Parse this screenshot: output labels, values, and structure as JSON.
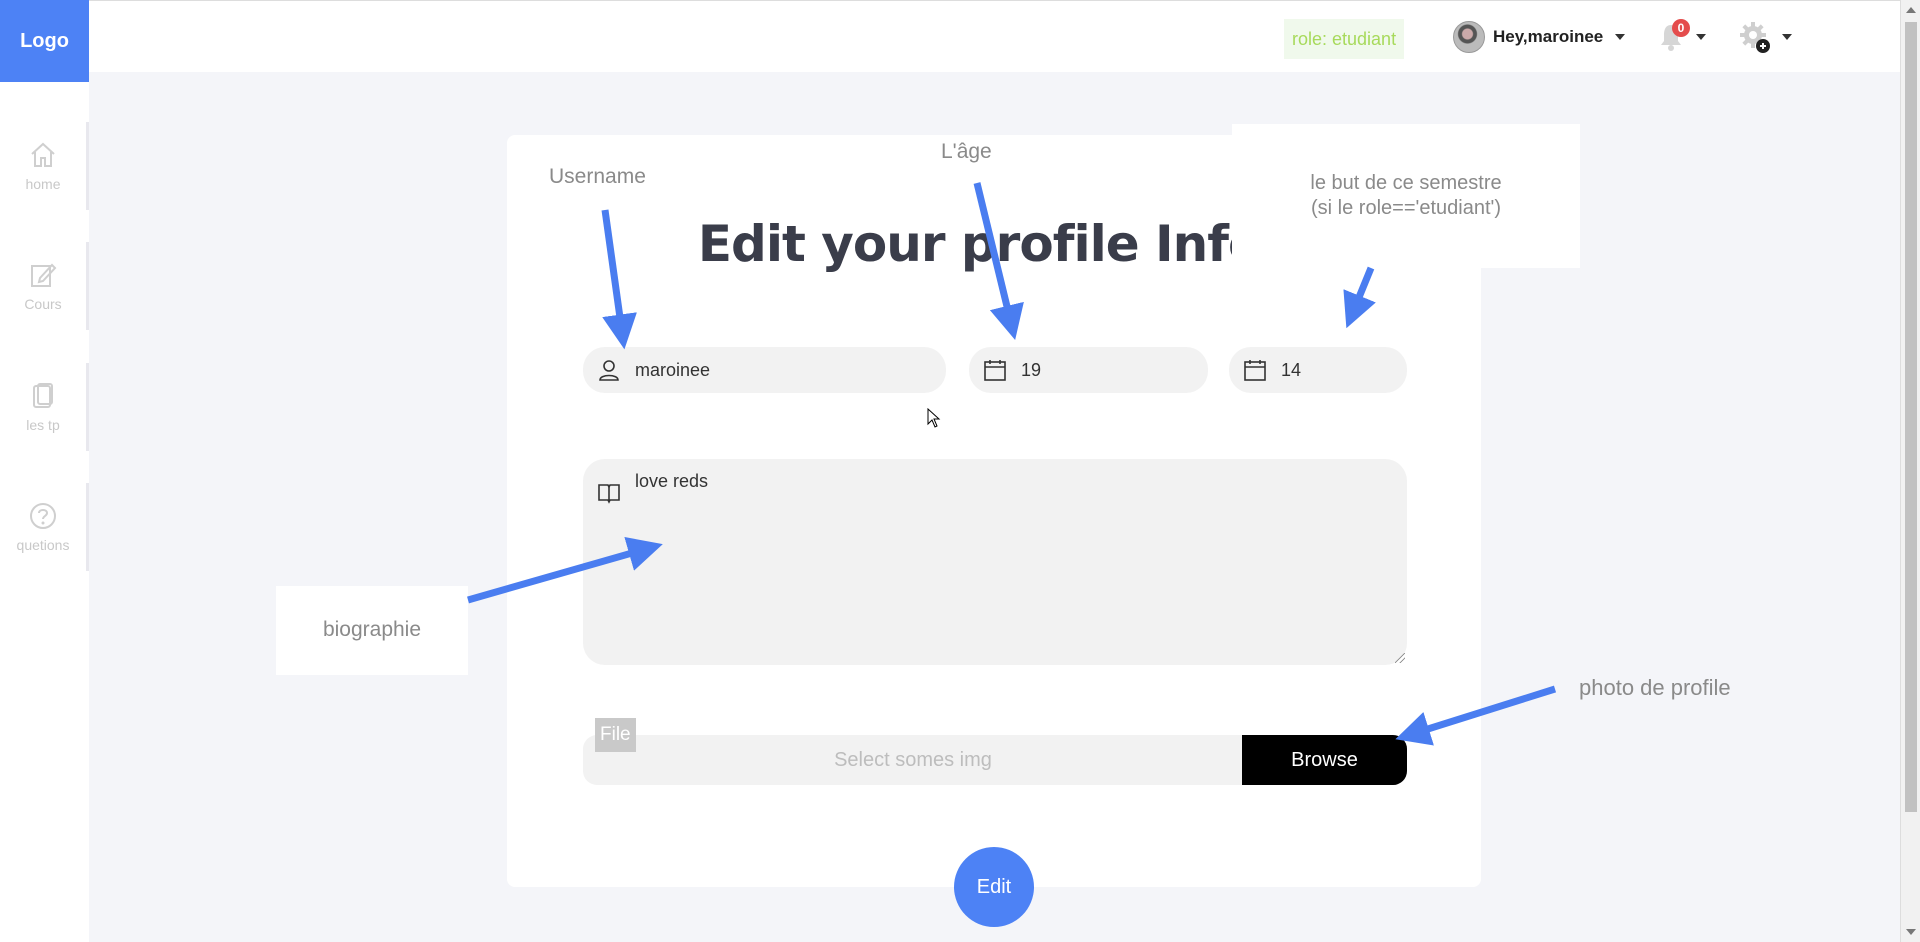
{
  "brand": {
    "logo": "Logo"
  },
  "topbar": {
    "role_badge": "role: etudiant",
    "user_greeting": "Hey,maroinee",
    "notification_count": "0"
  },
  "sidebar": {
    "items": [
      {
        "label": "home",
        "icon": "home-icon"
      },
      {
        "label": "Cours",
        "icon": "edit-icon"
      },
      {
        "label": "les tp",
        "icon": "files-icon"
      },
      {
        "label": "quetions",
        "icon": "help-icon"
      }
    ]
  },
  "form": {
    "title": "Edit your profile Infos",
    "username_value": "maroinee",
    "age_value": "19",
    "semester_goal_value": "14",
    "bio_value": "love reds",
    "file_label": "File",
    "file_placeholder": "Select somes img",
    "browse_label": "Browse",
    "edit_label": "Edit"
  },
  "annotations": {
    "username": "Username",
    "age": "L'âge",
    "semester_goal_line1": "le but de ce semestre",
    "semester_goal_line2": "(si le role=='etudiant')",
    "bio": "biographie",
    "photo": "photo de profile"
  },
  "colors": {
    "accent": "#4d82f5",
    "role_badge_text": "#a7da5b",
    "notification": "#e44c4c",
    "arrow": "#4a7df0"
  }
}
